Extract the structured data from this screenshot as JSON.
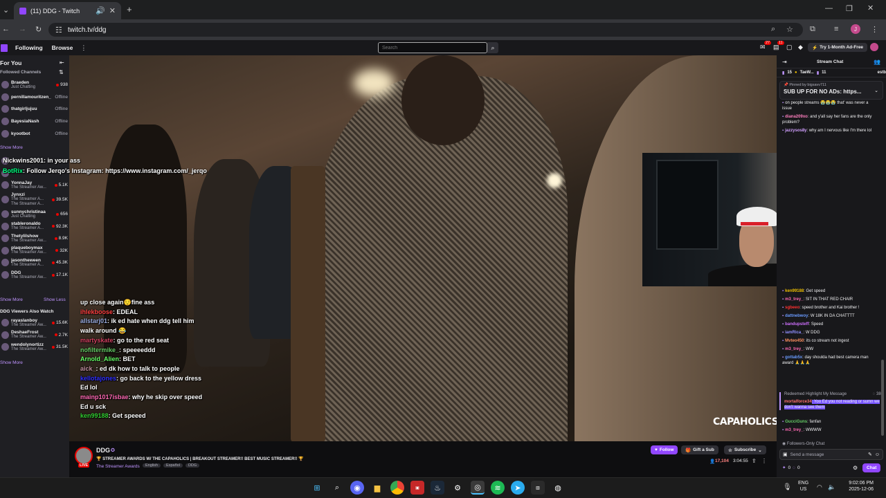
{
  "browser": {
    "tab_title": "(11) DDG - Twitch",
    "url": "twitch.tv/ddg",
    "profile_initial": "J"
  },
  "twitch": {
    "nav_following": "Following",
    "nav_browse": "Browse",
    "search_placeholder": "Search",
    "notif_count_1": "27",
    "notif_count_2": "11",
    "ad_free": "Try 1-Month Ad-Free"
  },
  "sidebar": {
    "for_you": "For You",
    "followed": "Followed Channels",
    "followed_list": [
      {
        "name": "Braeden",
        "sub": "Just Chatting",
        "count": "938",
        "live": true
      },
      {
        "name": "pernillamouritzen_",
        "sub": "",
        "count": "Offline",
        "live": false
      },
      {
        "name": "thatgirljujuu",
        "sub": "",
        "count": "Offline",
        "live": false
      },
      {
        "name": "BayesiaNash",
        "sub": "",
        "count": "Offline",
        "live": false
      },
      {
        "name": "kyootbot",
        "sub": "",
        "count": "Offline",
        "live": false
      }
    ],
    "show_more": "Show More",
    "rec_list": [
      {
        "name": "",
        "sub": "",
        "count": "",
        "live": true
      },
      {
        "name": "",
        "sub": "",
        "count": "",
        "live": true
      },
      {
        "name": "YonnaJay",
        "sub": "The Streamer Aw...",
        "count": "5.1K",
        "live": true
      },
      {
        "name": "Jynxzi",
        "sub": "The Streamer A...",
        "count": "39.5K",
        "live": true
      },
      {
        "name": "sunnychristinaa",
        "sub": "Just Chatting",
        "count": "656",
        "live": true
      },
      {
        "name": "stableronaldo",
        "sub": "The Streamer A...",
        "count": "92.3K",
        "live": true
      },
      {
        "name": "Thetylilshow",
        "sub": "The Streamer Aw...",
        "count": "8.9K",
        "live": true
      },
      {
        "name": "plaqueboymax",
        "sub": "The Streamer Aw...",
        "count": "32K",
        "live": true
      },
      {
        "name": "jasontheween",
        "sub": "The Streamer A...",
        "count": "45.3K",
        "live": true
      },
      {
        "name": "DDG",
        "sub": "The Streamer Aw...",
        "count": "17.1K",
        "live": true
      }
    ],
    "rec_sub3": "The Streamer A...",
    "show_more2": "Show More",
    "show_less": "Show Less",
    "also_watch": "DDG Viewers Also Watch",
    "also_list": [
      {
        "name": "rayaslanboy",
        "sub": "The Streamer Aw...",
        "count": "15.6K"
      },
      {
        "name": "DeshaeFrost",
        "sub": "The Streamer Aw...",
        "count": "2.7K"
      },
      {
        "name": "wendolynortizz",
        "sub": "The Streamer Aw...",
        "count": "31.5K"
      }
    ],
    "show_more3": "Show More"
  },
  "overlay_chat": [
    {
      "user": "Nickwins2001",
      "text": ": in your ass",
      "color": "#ffffff"
    },
    {
      "user": "BotRix",
      "text": ": Follow Jerqo's Instagram: https://www.instagram.com/_jerqo",
      "color": "#00ff7f"
    }
  ],
  "video_chat": [
    {
      "user": "",
      "text": "up close again😌fine ass",
      "color": "#fff"
    },
    {
      "user": "ihlekboose",
      "text": ": EDEAL",
      "color": "#ff4040"
    },
    {
      "user": "allstarj01",
      "text": ": ik ed hate when ddg tell him walk around 😂",
      "color": "#9ad"
    },
    {
      "user": "martyskate",
      "text": ": go to the red seat",
      "color": "#d04060"
    },
    {
      "user": "nofiltermike_",
      "text": ": speeeeddd",
      "color": "#66cc66"
    },
    {
      "user": "Arnold_Alien",
      "text": ": BET",
      "color": "#66ff66"
    },
    {
      "user": "aick_",
      "text": ": ed dk how to talk to people",
      "color": "#c090a0"
    },
    {
      "user": "kellotajones",
      "text": ": go back to the yellow dress Ed lol",
      "color": "#3030ff"
    },
    {
      "user": "mainp1017isbae",
      "text": ": why he skip over speed Ed u sck",
      "color": "#ff69b4"
    },
    {
      "user": "ken99188",
      "text": ": Get speeed",
      "color": "#32cd32"
    }
  ],
  "watermark": "CAPAHOLICS",
  "stream": {
    "channel": "DDG",
    "title": "🏆 STREAMER AWARDS W/ THE CAPAHOLICS | BREAKOUT STREAMER!! BEST MUSIC STREAMER!! 🏆",
    "category": "The Streamer Awards",
    "tags": [
      "English",
      "Español",
      "DDG"
    ],
    "live_badge": "LIVE",
    "follow": "Follow",
    "gift": "Gift a Sub",
    "subscribe": "Subscribe",
    "viewers": "17,104",
    "uptime": "3:04:55"
  },
  "chat": {
    "title": "Stream Chat",
    "top_1": "15",
    "top_2": "TaeW...",
    "top_3": "11",
    "top_4": "estb",
    "pinned_by": "Pinned by",
    "pinned_user": "bigsavv711",
    "pinned_text": "SUB UP FOR NO ADs: https...",
    "messages": [
      {
        "user": "",
        "text": "on people streams 😭😭😭 that' was never a issue",
        "color": "#bf94ff"
      },
      {
        "user": "diana209xo",
        "text": ": and y'all say her fans are the only problem?",
        "color": "#ff7fbf"
      },
      {
        "user": "jazzysos8y",
        "text": ": why am I nervous like I'm there lol",
        "color": "#d2a0ff"
      }
    ],
    "messages2": [
      {
        "user": "ken99188",
        "text": ": Get speed",
        "color": "#f0c000"
      },
      {
        "user": "m3_trey_",
        "text": ": SIT IN THAT RED CHAIR",
        "color": "#ff69b4"
      },
      {
        "user": "sgbeeo",
        "text": ": speed brother and Kai brother !",
        "color": "#ff3030"
      },
      {
        "user": "dattnebwoy",
        "text": ": W 18K IN DA CHATTTT",
        "color": "#6a9bff"
      },
      {
        "user": "bandupsteff",
        "text": ": Speed",
        "color": "#d070ff"
      },
      {
        "user": "iamRica_",
        "text": ": W DDG",
        "color": "#9090ff"
      },
      {
        "user": "Mvteo450",
        "text": ": its co stream not ingest",
        "color": "#ff9060"
      },
      {
        "user": "m3_trey_",
        "text": ": WW",
        "color": "#ff69b4"
      },
      {
        "user": "gottab5x",
        "text": ": day shoulda had best camera man award 🙏🙏🙏",
        "color": "#6a9bff"
      }
    ],
    "redeemed": "Redeemed Highlight My Message",
    "redeem_cost": "380",
    "highlight_user": "mortalforce34",
    "highlight_text": ": Yoo Ed you not reading or sumn we don't wanna see them",
    "messages3": [
      {
        "user": "GucciGuns",
        "text": ": fanfan",
        "color": "#66cc66"
      },
      {
        "user": "m3_trey_",
        "text": ": WWWW",
        "color": "#ff69b4"
      }
    ],
    "followers_only": "Followers-Only Chat",
    "send_placeholder": "Send a message",
    "points_1": "0",
    "points_2": "0",
    "chat_btn": "Chat"
  },
  "taskbar": {
    "lang": "ENG",
    "region": "US",
    "time": "9:02:06 PM",
    "date": "2025-12-06"
  }
}
